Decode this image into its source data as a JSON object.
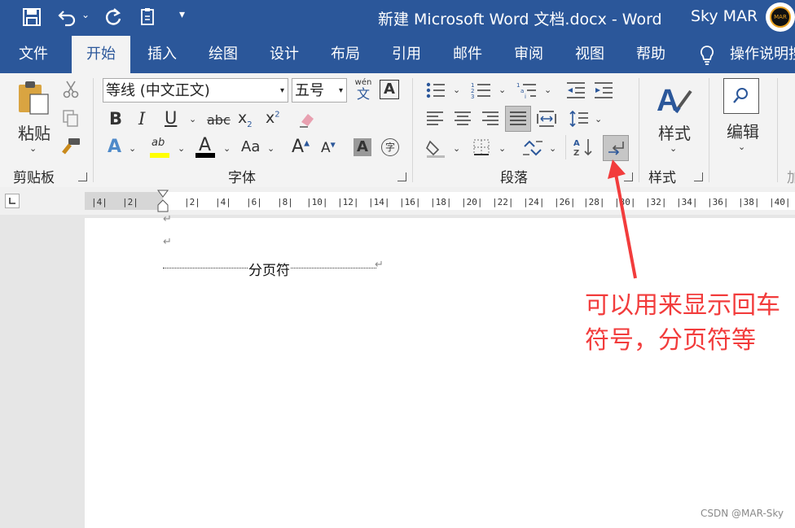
{
  "window": {
    "title": "新建 Microsoft Word 文档.docx  -  Word",
    "user": "Sky MAR",
    "avatar_text": "MAR"
  },
  "tabs": [
    "文件",
    "开始",
    "插入",
    "绘图",
    "设计",
    "布局",
    "引用",
    "邮件",
    "审阅",
    "视图",
    "帮助"
  ],
  "tell_me": "操作说明搜",
  "clipboard": {
    "paste": "粘贴",
    "label": "剪贴板"
  },
  "font": {
    "name": "等线 (中文正文)",
    "size": "五号",
    "phonetic": "wén\n文",
    "label": "字体"
  },
  "paragraph": {
    "label": "段落"
  },
  "styles": {
    "button": "样式",
    "label": "样式"
  },
  "editing": {
    "button": "编辑"
  },
  "ruler": {
    "ticks": [
      "4",
      "2",
      "2",
      "4",
      "6",
      "8",
      "10",
      "12",
      "14",
      "16",
      "18",
      "20",
      "22",
      "24",
      "26",
      "28",
      "30",
      "32",
      "34",
      "36",
      "38",
      "40"
    ]
  },
  "document": {
    "page_break_text": "分页符"
  },
  "annotation": "可以用来显示回车符号，分页符等",
  "watermark": "CSDN @MAR-Sky",
  "colors": {
    "accent": "#2b579a",
    "annotation": "#f23c3c",
    "highlight": "#ffff00",
    "font_color": "#000000"
  }
}
